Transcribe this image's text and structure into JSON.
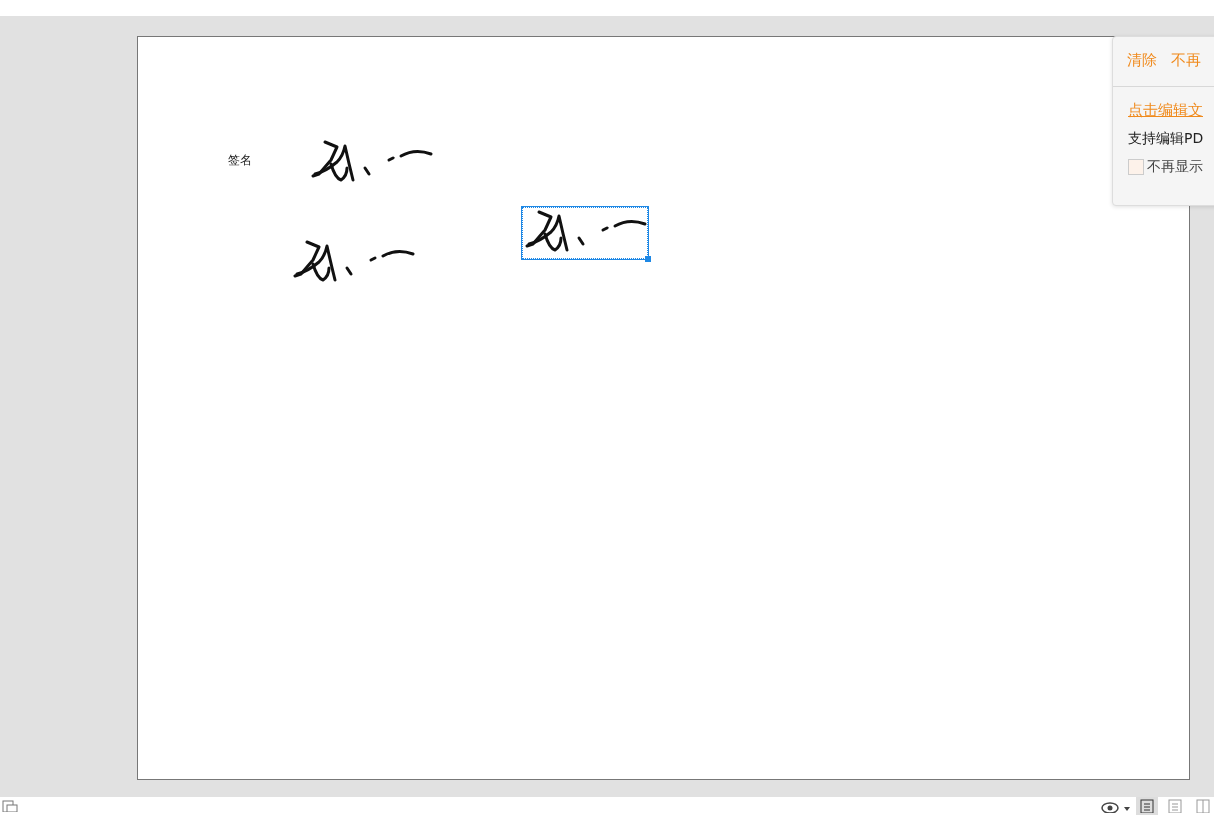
{
  "page": {
    "label": "签名",
    "signatures": [
      {
        "selected": false
      },
      {
        "selected": false
      },
      {
        "selected": true
      }
    ]
  },
  "popup": {
    "actions": [
      "清除",
      "不再"
    ],
    "link": "点击编辑文",
    "description": "支持编辑PD",
    "checkbox": {
      "label": "不再显示",
      "checked": false
    }
  },
  "status_bar": {
    "view_modes": [
      {
        "selected": true
      },
      {
        "selected": false
      },
      {
        "selected": false
      }
    ]
  }
}
